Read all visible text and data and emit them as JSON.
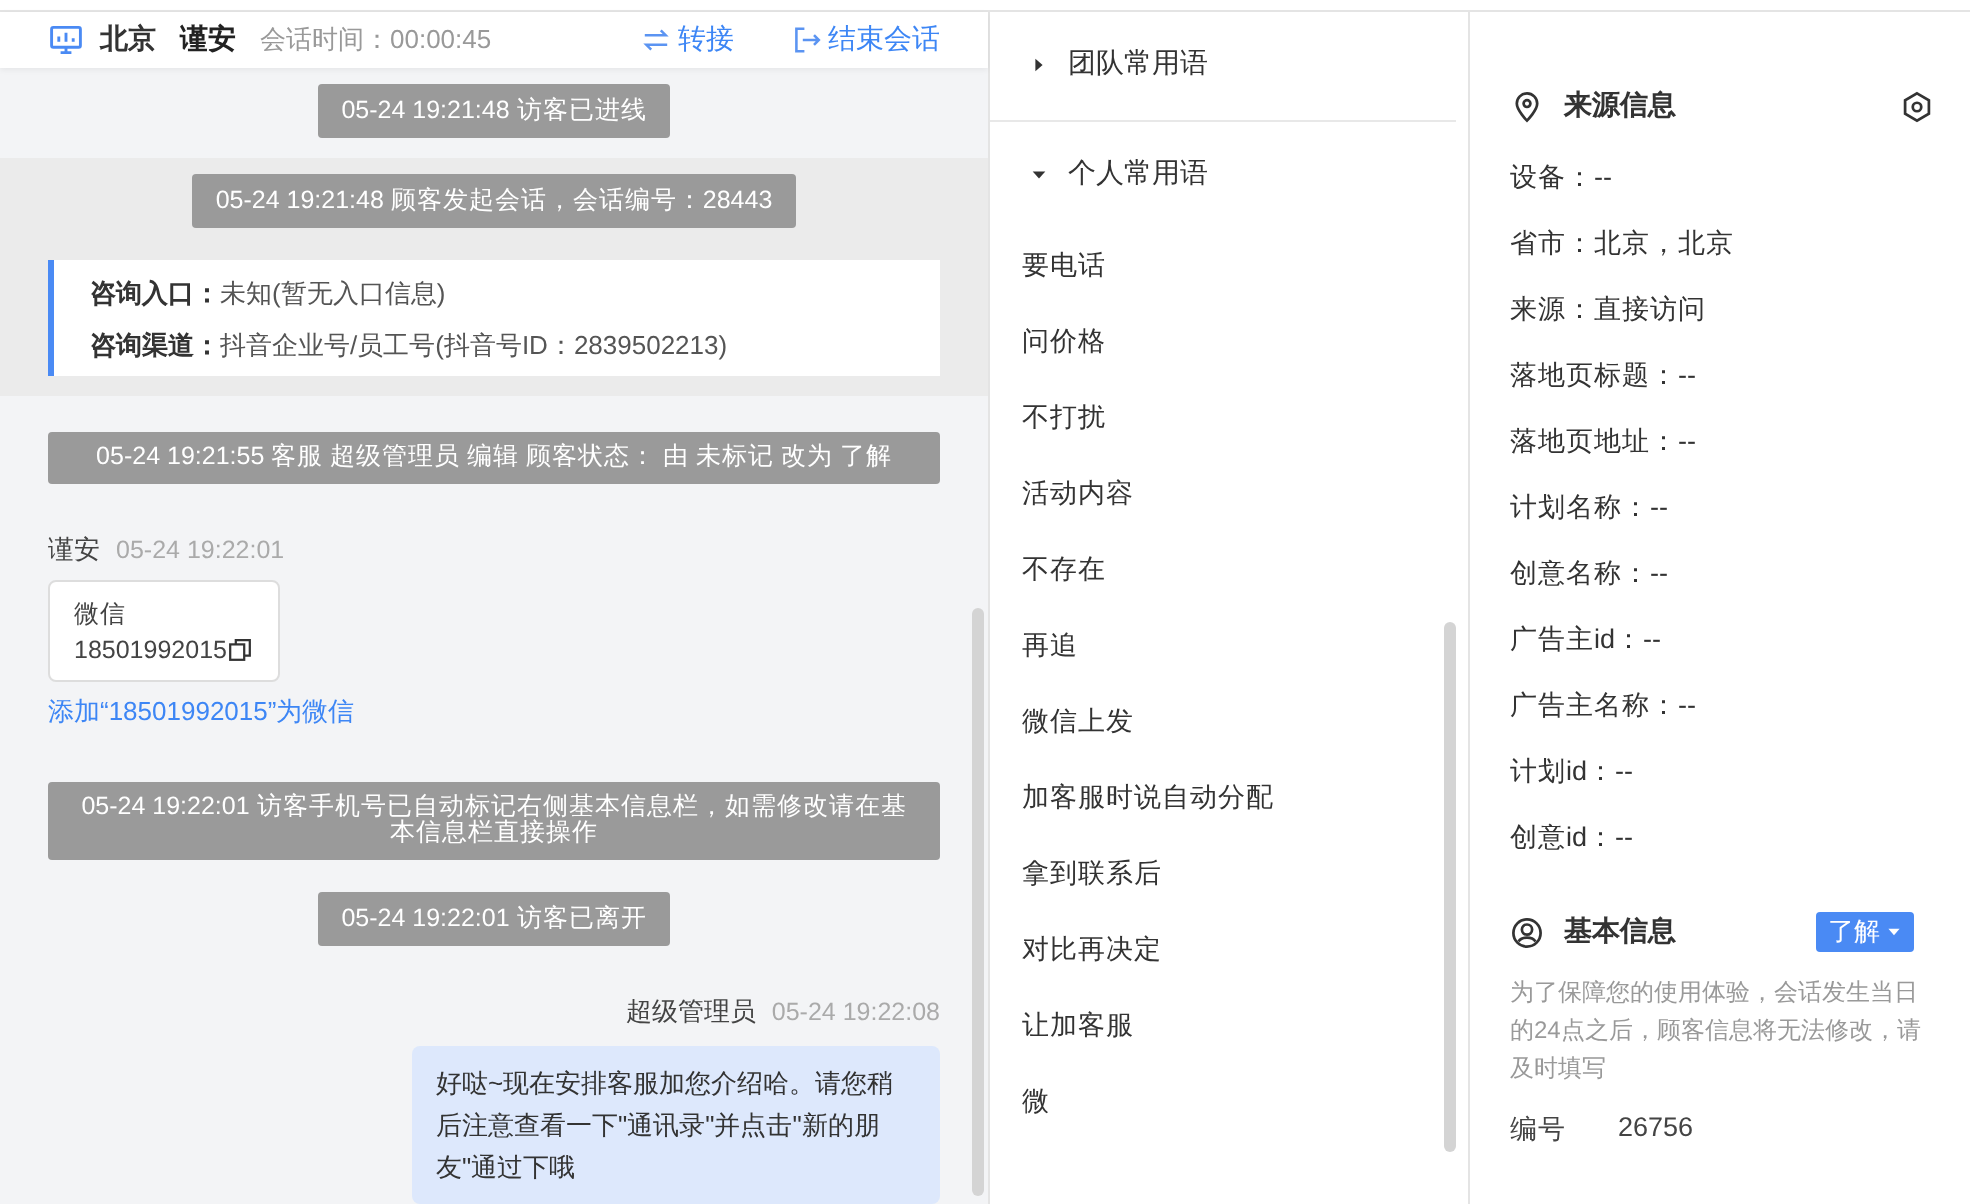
{
  "header": {
    "location": "北京",
    "visitor": "谨安",
    "session_time": "会话时间：00:00:45",
    "actions": [
      {
        "kind": "transfer",
        "label": "转接"
      },
      {
        "kind": "end",
        "label": "结束会话"
      }
    ]
  },
  "chat": {
    "messages": [
      {
        "kind": "notice",
        "text": "05-24 19:21:48 访客已进线"
      },
      {
        "kind": "session",
        "text": "05-24 19:21:48 顾客发起会话，会话编号：28443",
        "entry": [
          {
            "label": "咨询入口：",
            "value": "未知(暂无入口信息)"
          },
          {
            "label": "咨询渠道：",
            "value": "抖音企业号/员工号(抖音号ID：2839502213)"
          }
        ]
      },
      {
        "kind": "notice",
        "text": "05-24 19:21:55 客服 超级管理员 编辑 顾客状态： 由 未标记 改为 了解"
      },
      {
        "kind": "visitor",
        "sender": "谨安",
        "time": "05-24 19:22:01",
        "card_title": "微信",
        "card_value": "18501992015",
        "link": "添加“18501992015”为微信"
      },
      {
        "kind": "notice",
        "text": "05-24 19:22:01 访客手机号已自动标记右侧基本信息栏，如需修改请在基本信息栏直接操作"
      },
      {
        "kind": "notice",
        "text": "05-24 19:22:01 访客已离开"
      },
      {
        "kind": "agent",
        "sender": "超级管理员",
        "time": "05-24 19:22:08",
        "text": "好哒~现在安排客服加您介绍哈。请您稍后注意查看一下\"通讯录\"并点击\"新的朋友\"通过下哦"
      }
    ]
  },
  "phrases": {
    "groups": [
      {
        "title": "团队常用语",
        "expanded": false
      },
      {
        "title": "个人常用语",
        "expanded": true,
        "items": [
          "要电话",
          "问价格",
          "不打扰",
          "活动内容",
          "不存在",
          "再追",
          "微信上发",
          "加客服时说自动分配",
          "拿到联系后",
          "对比再决定",
          "让加客服",
          "微"
        ]
      }
    ]
  },
  "info": {
    "source": {
      "title": "来源信息",
      "fields": [
        "设备：--",
        "省市：北京，北京",
        "来源：直接访问",
        "落地页标题：--",
        "落地页地址：--",
        "计划名称：--",
        "创意名称：--",
        "广告主id：--",
        "广告主名称：--",
        "计划id：--",
        "创意id：--"
      ]
    },
    "basic": {
      "title": "基本信息",
      "status": "了解",
      "notice": "为了保障您的使用体验，会话发生当日的24点之后，顾客信息将无法修改，请及时填写",
      "fields": [
        {
          "label": "编号",
          "value": "26756"
        }
      ]
    }
  }
}
